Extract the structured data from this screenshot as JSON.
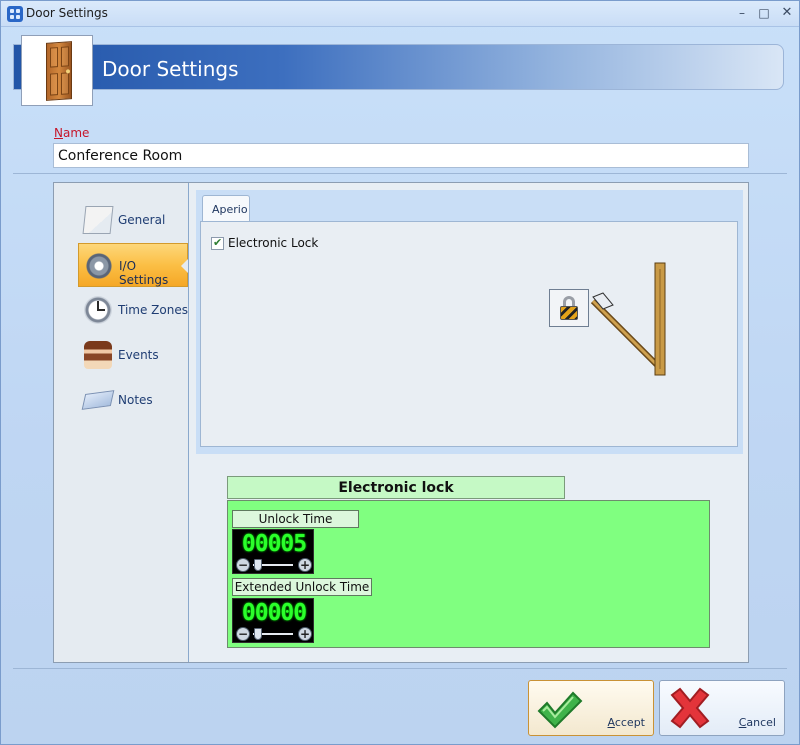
{
  "window": {
    "title": "Door Settings",
    "controls": {
      "minimize": "–",
      "maximize": "□",
      "close": "✕"
    }
  },
  "header": {
    "title": "Door Settings",
    "icon": "door-icon"
  },
  "name_field": {
    "label_accel": "N",
    "label_rest": "ame",
    "value": "Conference Room"
  },
  "sidebar": {
    "items": [
      {
        "label": "General",
        "icon": "pencil-icon",
        "active": false
      },
      {
        "label": "I/O Settings",
        "icon": "gear-icon",
        "active": true
      },
      {
        "label": "Time Zones",
        "icon": "clock-icon",
        "active": false
      },
      {
        "label": "Events",
        "icon": "cake-icon",
        "active": false
      },
      {
        "label": "Notes",
        "icon": "notes-icon",
        "active": false
      }
    ]
  },
  "tabs": [
    {
      "label": "Aperio",
      "selected": true
    }
  ],
  "aperio": {
    "electronic_lock_label": "Electronic Lock",
    "electronic_lock_checked": true
  },
  "electronic_lock": {
    "title": "Electronic lock",
    "unlock_time_label": "Unlock Time",
    "unlock_time_value": "00005",
    "extended_unlock_time_label": "Extended Unlock Time",
    "extended_unlock_time_value": "00000",
    "minus_symbol": "−",
    "plus_symbol": "+"
  },
  "buttons": {
    "accept_accel": "A",
    "accept_rest": "ccept",
    "cancel_accel": "C",
    "cancel_rest": "ancel"
  },
  "colors": {
    "accent_blue": "#2255a8",
    "active_nav": "#fbbf45",
    "lock_panel_green": "#80ff80",
    "counter_digit_green": "#2bff2b",
    "required_label_red": "#c6162a"
  }
}
